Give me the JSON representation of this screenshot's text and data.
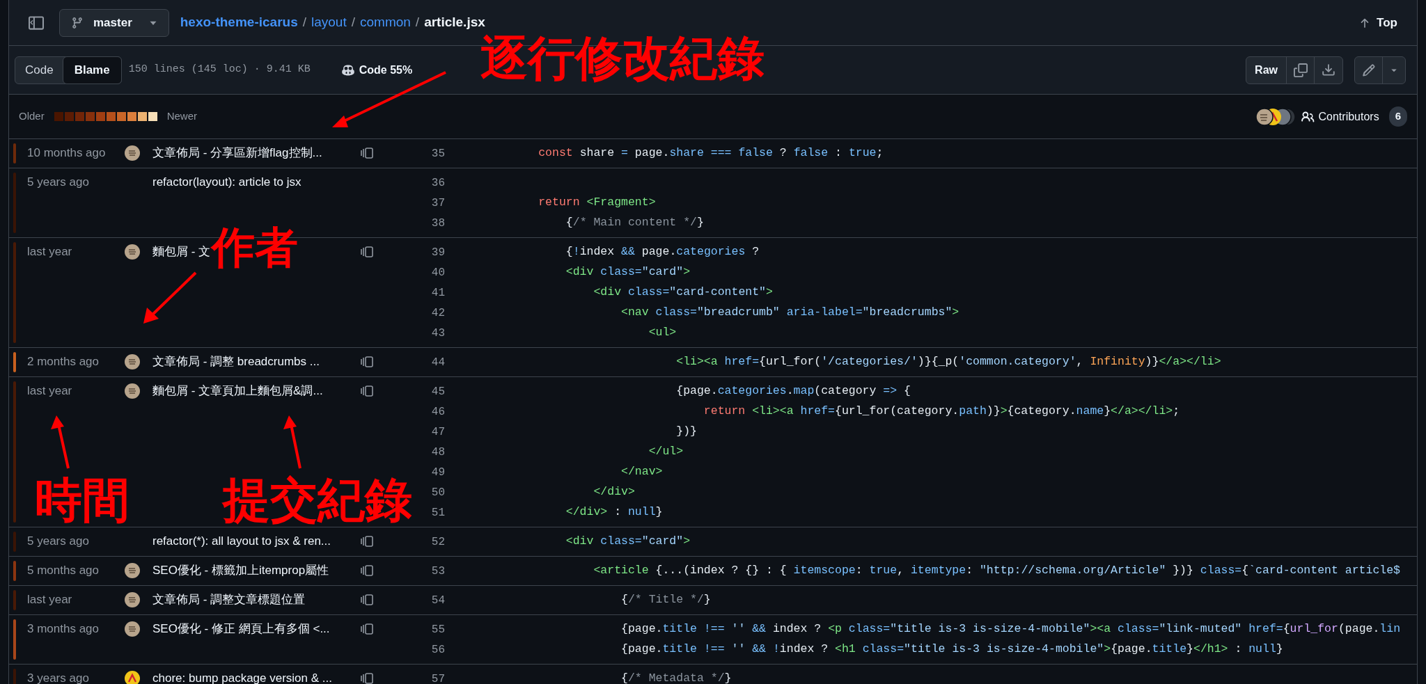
{
  "header": {
    "branch": "master",
    "breadcrumb": [
      {
        "text": "hexo-theme-icarus",
        "kind": "link"
      },
      {
        "text": "/",
        "kind": "separator"
      },
      {
        "text": "layout",
        "kind": "link"
      },
      {
        "text": "/",
        "kind": "separator"
      },
      {
        "text": "common",
        "kind": "link"
      },
      {
        "text": "/",
        "kind": "separator"
      },
      {
        "text": "article.jsx",
        "kind": "current"
      }
    ],
    "top_button": "Top"
  },
  "toolbar": {
    "view_tabs": [
      {
        "label": "Code",
        "selected": false
      },
      {
        "label": "Blame",
        "selected": true
      }
    ],
    "file_info": "150 lines (145 loc) · 9.41 KB",
    "copilot_note": "Code 55%",
    "raw_button": "Raw"
  },
  "legend": {
    "older": "Older",
    "newer": "Newer",
    "scale": [
      {
        "color": "#4a1500"
      },
      {
        "color": "#5c1c04"
      },
      {
        "color": "#722508"
      },
      {
        "color": "#87300c"
      },
      {
        "color": "#a03e12"
      },
      {
        "color": "#b5501b"
      },
      {
        "color": "#c96628"
      },
      {
        "color": "#dc7f3c"
      },
      {
        "color": "#ecb271"
      },
      {
        "color": "#f7dfb8"
      }
    ],
    "contributors_label": "Contributors",
    "contributors_count": "6"
  },
  "blame": [
    {
      "age": "10 months ago",
      "color": "#6e2a0a",
      "kind": "photo",
      "message": "文章佈局 - 分享區新增flag控制...",
      "reblame": true,
      "lines": [
        {
          "number": "35",
          "code": [
            {
              "text": "        const",
              "kind": "keyword"
            },
            {
              "text": " share ",
              "kind": "plain"
            },
            {
              "text": "=",
              "kind": "constant"
            },
            {
              "text": " page.",
              "kind": "plain"
            },
            {
              "text": "share",
              "kind": "constant"
            },
            {
              "text": " ===",
              "kind": "constant"
            },
            {
              "text": " false",
              "kind": "constant"
            },
            {
              "text": " ? ",
              "kind": "plain"
            },
            {
              "text": "false",
              "kind": "constant"
            },
            {
              "text": " : ",
              "kind": "plain"
            },
            {
              "text": "true",
              "kind": "constant"
            },
            {
              "text": ";",
              "kind": "plain"
            }
          ]
        }
      ]
    },
    {
      "age": "5 years ago",
      "color": "#3a1405",
      "kind": "none",
      "message": "refactor(layout): article to jsx",
      "reblame": false,
      "lines": [
        {
          "number": "36"
        },
        {
          "number": "37",
          "code": [
            {
              "text": "        return",
              "kind": "keyword"
            },
            {
              "text": " <Fragment>",
              "kind": "tag"
            }
          ]
        },
        {
          "number": "38",
          "code": [
            {
              "text": "            {",
              "kind": "plain"
            },
            {
              "text": "/* Main content */",
              "kind": "comment"
            },
            {
              "text": "}",
              "kind": "plain"
            }
          ]
        }
      ]
    },
    {
      "age": "last year",
      "color": "#4a1a06",
      "kind": "photo",
      "message": "麵包屑 - 文",
      "reblame": true,
      "lines": [
        {
          "number": "39",
          "code": [
            {
              "text": "            {",
              "kind": "plain"
            },
            {
              "text": "!",
              "kind": "constant"
            },
            {
              "text": "index ",
              "kind": "plain"
            },
            {
              "text": "&&",
              "kind": "constant"
            },
            {
              "text": " page.",
              "kind": "plain"
            },
            {
              "text": "categories",
              "kind": "constant"
            },
            {
              "text": " ?",
              "kind": "plain"
            }
          ]
        },
        {
          "number": "40",
          "code": [
            {
              "text": "            <div",
              "kind": "tag"
            },
            {
              "text": " class=",
              "kind": "constant"
            },
            {
              "text": "\"card\"",
              "kind": "string"
            },
            {
              "text": ">",
              "kind": "tag"
            }
          ]
        },
        {
          "number": "41",
          "code": [
            {
              "text": "                <div",
              "kind": "tag"
            },
            {
              "text": " class=",
              "kind": "constant"
            },
            {
              "text": "\"card-content\"",
              "kind": "string"
            },
            {
              "text": ">",
              "kind": "tag"
            }
          ]
        },
        {
          "number": "42",
          "code": [
            {
              "text": "                    <nav",
              "kind": "tag"
            },
            {
              "text": " class=",
              "kind": "constant"
            },
            {
              "text": "\"breadcrumb\"",
              "kind": "string"
            },
            {
              "text": " aria-label=",
              "kind": "constant"
            },
            {
              "text": "\"breadcrumbs\"",
              "kind": "string"
            },
            {
              "text": ">",
              "kind": "tag"
            }
          ]
        },
        {
          "number": "43",
          "code": [
            {
              "text": "                        <ul>",
              "kind": "tag"
            }
          ]
        }
      ]
    },
    {
      "age": "2 months ago",
      "color": "#c8601f",
      "kind": "photo",
      "message": "文章佈局 - 調整 breadcrumbs ...",
      "reblame": true,
      "lines": [
        {
          "number": "44",
          "code": [
            {
              "text": "                            <li><a",
              "kind": "tag"
            },
            {
              "text": " href=",
              "kind": "constant"
            },
            {
              "text": "{url_for(",
              "kind": "plain"
            },
            {
              "text": "'/categories/'",
              "kind": "string"
            },
            {
              "text": ")}{_p(",
              "kind": "plain"
            },
            {
              "text": "'common.category'",
              "kind": "string"
            },
            {
              "text": ", ",
              "kind": "plain"
            },
            {
              "text": "Infinity",
              "kind": "number"
            },
            {
              "text": ")}",
              "kind": "plain"
            },
            {
              "text": "</a></li>",
              "kind": "tag"
            }
          ]
        }
      ]
    },
    {
      "age": "last year",
      "color": "#4a1a06",
      "kind": "photo",
      "message": "麵包屑 - 文章頁加上麵包屑&調...",
      "reblame": true,
      "lines": [
        {
          "number": "45",
          "code": [
            {
              "text": "                            {page.",
              "kind": "plain"
            },
            {
              "text": "categories",
              "kind": "constant"
            },
            {
              "text": ".",
              "kind": "plain"
            },
            {
              "text": "map",
              "kind": "constant"
            },
            {
              "text": "(category ",
              "kind": "plain"
            },
            {
              "text": "=>",
              "kind": "constant"
            },
            {
              "text": " {",
              "kind": "plain"
            }
          ]
        },
        {
          "number": "46",
          "code": [
            {
              "text": "                                return",
              "kind": "keyword"
            },
            {
              "text": " <li><a",
              "kind": "tag"
            },
            {
              "text": " href=",
              "kind": "constant"
            },
            {
              "text": "{url_for(category.",
              "kind": "plain"
            },
            {
              "text": "path",
              "kind": "constant"
            },
            {
              "text": ")}",
              "kind": "plain"
            },
            {
              "text": ">",
              "kind": "tag"
            },
            {
              "text": "{category.",
              "kind": "plain"
            },
            {
              "text": "name",
              "kind": "constant"
            },
            {
              "text": "}",
              "kind": "plain"
            },
            {
              "text": "</a></li>",
              "kind": "tag"
            },
            {
              "text": ";",
              "kind": "plain"
            }
          ]
        },
        {
          "number": "47",
          "code": [
            {
              "text": "                            })}",
              "kind": "plain"
            }
          ]
        },
        {
          "number": "48",
          "code": [
            {
              "text": "                        </ul>",
              "kind": "tag"
            }
          ]
        },
        {
          "number": "49",
          "code": [
            {
              "text": "                    </nav>",
              "kind": "tag"
            }
          ]
        },
        {
          "number": "50",
          "code": [
            {
              "text": "                </div>",
              "kind": "tag"
            }
          ]
        },
        {
          "number": "51",
          "code": [
            {
              "text": "            </div>",
              "kind": "tag"
            },
            {
              "text": " : ",
              "kind": "plain"
            },
            {
              "text": "null",
              "kind": "constant"
            },
            {
              "text": "}",
              "kind": "plain"
            }
          ]
        }
      ]
    },
    {
      "age": "5 years ago",
      "color": "#3a1405",
      "kind": "none",
      "message": "refactor(*): all layout to jsx & ren...",
      "reblame": true,
      "lines": [
        {
          "number": "52",
          "code": [
            {
              "text": "            <div",
              "kind": "tag"
            },
            {
              "text": " class=",
              "kind": "constant"
            },
            {
              "text": "\"card\"",
              "kind": "string"
            },
            {
              "text": ">",
              "kind": "tag"
            }
          ]
        }
      ]
    },
    {
      "age": "5 months ago",
      "color": "#8c3510",
      "kind": "photo",
      "message": "SEO優化 - 標籤加上itemprop屬性",
      "reblame": true,
      "lines": [
        {
          "number": "53",
          "code": [
            {
              "text": "                <article",
              "kind": "tag"
            },
            {
              "text": " {...(index ? {} : { ",
              "kind": "plain"
            },
            {
              "text": "itemscope",
              "kind": "constant"
            },
            {
              "text": ": ",
              "kind": "plain"
            },
            {
              "text": "true",
              "kind": "constant"
            },
            {
              "text": ", ",
              "kind": "plain"
            },
            {
              "text": "itemtype",
              "kind": "constant"
            },
            {
              "text": ": ",
              "kind": "plain"
            },
            {
              "text": "\"http://schema.org/Article\"",
              "kind": "string"
            },
            {
              "text": " })} ",
              "kind": "plain"
            },
            {
              "text": "class=",
              "kind": "constant"
            },
            {
              "text": "{",
              "kind": "plain"
            },
            {
              "text": "`card-content article$",
              "kind": "string"
            }
          ]
        }
      ]
    },
    {
      "age": "last year",
      "color": "#4a1a06",
      "kind": "photo",
      "message": "文章佈局 - 調整文章標題位置",
      "reblame": true,
      "lines": [
        {
          "number": "54",
          "code": [
            {
              "text": "                    {",
              "kind": "plain"
            },
            {
              "text": "/* Title */",
              "kind": "comment"
            },
            {
              "text": "}",
              "kind": "plain"
            }
          ]
        }
      ]
    },
    {
      "age": "3 months ago",
      "color": "#a8461a",
      "kind": "photo",
      "message": "SEO優化 - 修正 網頁上有多個 <...",
      "reblame": true,
      "lines": [
        {
          "number": "55",
          "code": [
            {
              "text": "                    {page.",
              "kind": "plain"
            },
            {
              "text": "title",
              "kind": "constant"
            },
            {
              "text": " !==",
              "kind": "constant"
            },
            {
              "text": " ''",
              "kind": "string"
            },
            {
              "text": " &&",
              "kind": "constant"
            },
            {
              "text": " index ? ",
              "kind": "plain"
            },
            {
              "text": "<p",
              "kind": "tag"
            },
            {
              "text": " class=",
              "kind": "constant"
            },
            {
              "text": "\"title is-3 is-size-4-mobile\"",
              "kind": "string"
            },
            {
              "text": "><a",
              "kind": "tag"
            },
            {
              "text": " class=",
              "kind": "constant"
            },
            {
              "text": "\"link-muted\"",
              "kind": "string"
            },
            {
              "text": " href=",
              "kind": "constant"
            },
            {
              "text": "{",
              "kind": "plain"
            },
            {
              "text": "url_for",
              "kind": "function"
            },
            {
              "text": "(page.",
              "kind": "plain"
            },
            {
              "text": "lin",
              "kind": "constant"
            }
          ]
        },
        {
          "number": "56",
          "code": [
            {
              "text": "                    {page.",
              "kind": "plain"
            },
            {
              "text": "title",
              "kind": "constant"
            },
            {
              "text": " !==",
              "kind": "constant"
            },
            {
              "text": " ''",
              "kind": "string"
            },
            {
              "text": " &&",
              "kind": "constant"
            },
            {
              "text": " !",
              "kind": "constant"
            },
            {
              "text": "index ? ",
              "kind": "plain"
            },
            {
              "text": "<h1",
              "kind": "tag"
            },
            {
              "text": " class=",
              "kind": "constant"
            },
            {
              "text": "\"title is-3 is-size-4-mobile\"",
              "kind": "string"
            },
            {
              "text": ">",
              "kind": "tag"
            },
            {
              "text": "{page.",
              "kind": "plain"
            },
            {
              "text": "title",
              "kind": "constant"
            },
            {
              "text": "}",
              "kind": "plain"
            },
            {
              "text": "</h1>",
              "kind": "tag"
            },
            {
              "text": " : ",
              "kind": "plain"
            },
            {
              "text": "null",
              "kind": "constant"
            },
            {
              "text": "}",
              "kind": "plain"
            }
          ]
        }
      ]
    },
    {
      "age": "3 years ago",
      "color": "#3a1405",
      "kind": "logo",
      "message": "chore: bump package version & ...",
      "reblame": true,
      "lines": [
        {
          "number": "57",
          "code": [
            {
              "text": "                    {",
              "kind": "plain"
            },
            {
              "text": "/* Metadata */",
              "kind": "comment"
            },
            {
              "text": "}",
              "kind": "plain"
            }
          ]
        }
      ]
    }
  ],
  "annotations": [
    {
      "text": "逐行修改紀錄"
    },
    {
      "text": "作者"
    },
    {
      "text": "時間"
    },
    {
      "text": "提交紀錄"
    }
  ]
}
